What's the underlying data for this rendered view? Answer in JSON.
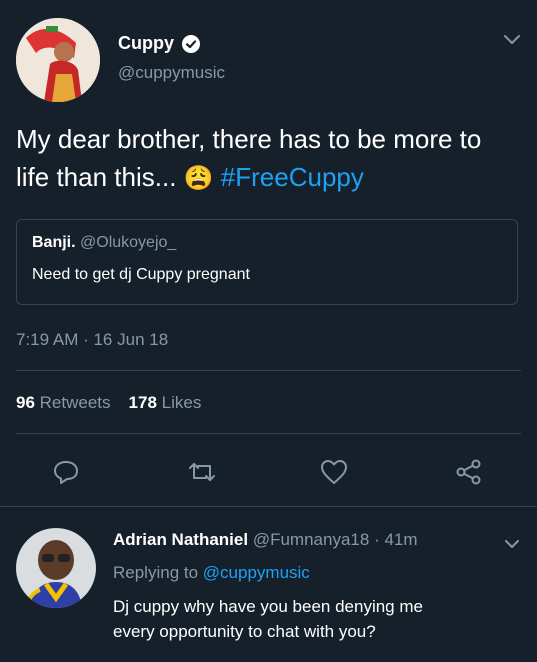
{
  "tweet": {
    "author_name": "Cuppy",
    "author_handle": "@cuppymusic",
    "text_main": "My dear brother, there has to be more to life than this...",
    "emoji": "😩",
    "hashtag": "#FreeCuppy",
    "timestamp": "7:19 AM · 16 Jun 18",
    "retweets_count": "96",
    "retweets_label": "Retweets",
    "likes_count": "178",
    "likes_label": "Likes"
  },
  "quoted_tweet": {
    "author_name": "Banji.",
    "author_handle": "@Olukoyejo_",
    "text": "Need to get dj Cuppy pregnant"
  },
  "reply": {
    "author_name": "Adrian Nathaniel",
    "author_handle": "@Fumnanya18",
    "time": "· 41m",
    "replying_prefix": "Replying to",
    "replying_handle": "@cuppymusic",
    "text_line1": "Dj cuppy why have you been denying me",
    "text_line2": "every opportunity to chat with you?"
  },
  "icons": {
    "verified": "verified-badge-icon",
    "chevron": "chevron-down-icon",
    "reply": "reply-icon",
    "retweet": "retweet-icon",
    "like": "heart-icon",
    "share": "share-icon"
  },
  "colors": {
    "background": "#15202b",
    "accent": "#1da1f2",
    "muted": "#8899a6",
    "border": "#38444d"
  }
}
